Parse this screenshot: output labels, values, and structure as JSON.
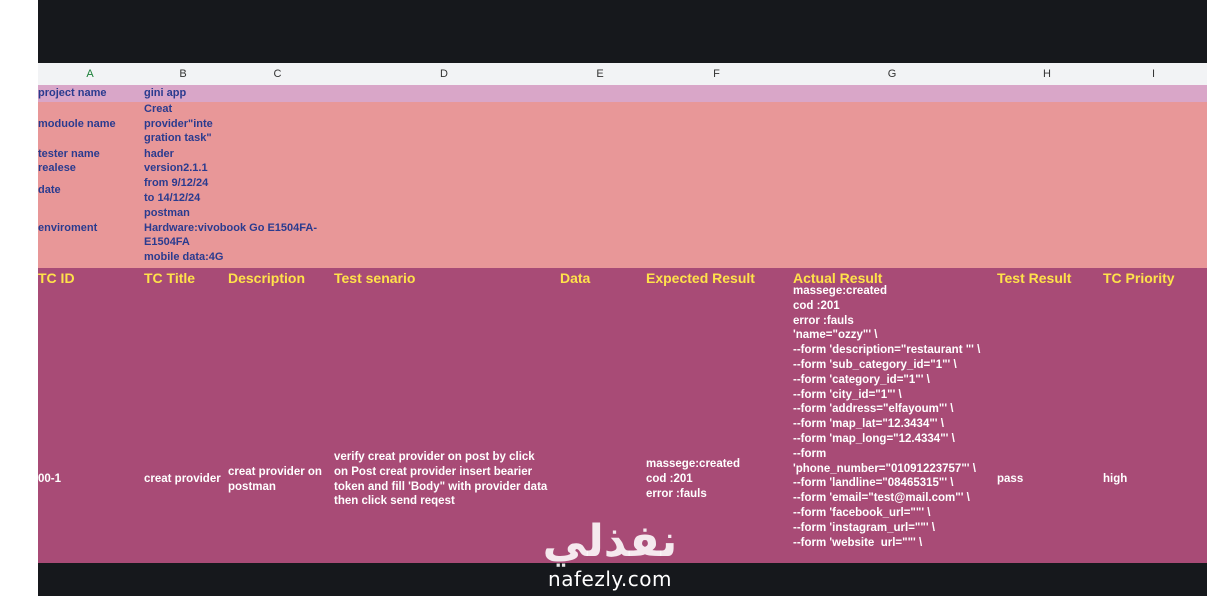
{
  "columns": [
    "A",
    "B",
    "C",
    "D",
    "E",
    "F",
    "G",
    "H",
    "I"
  ],
  "info": {
    "project_label": "project name",
    "project_value": "gini app",
    "module_label": "moduole name",
    "module_value": "Creat\nprovider\"inte\ngration task\"",
    "tester_label": "tester name",
    "tester_value": "hader",
    "release_label": "realese",
    "release_value": "version2.1.1",
    "date_label": "date",
    "date_value": "from 9/12/24\nto 14/12/24",
    "env_label": "enviroment",
    "env_value": "postman\nHardware:vivobook Go E1504FA-\nE1504FA\nmobile data:4G"
  },
  "table": {
    "headers": [
      "TC ID",
      "TC Title",
      "Description",
      "Test senario",
      "Data",
      "Expected Result",
      "Actual Result",
      "Test Result",
      "TC Priority"
    ],
    "row": {
      "id": "00-1",
      "title": "creat provider",
      "description": "creat provider on\npostman",
      "scenario": "verify creat provider on post by click\non Post creat provider insert bearier\ntoken and fill 'Body\" with provider data\nthen click send reqest",
      "data": "",
      "expected": "massege:created\ncod :201\nerror :fauls",
      "actual": "massege:created\ncod :201\nerror :fauls\n'name=\"ozzy\"' \\\n--form 'description=\"restaurant \"' \\\n--form 'sub_category_id=\"1\"' \\\n--form 'category_id=\"1\"' \\\n--form 'city_id=\"1\"' \\\n--form 'address=\"elfayoum\"' \\\n--form 'map_lat=\"12.3434\"' \\\n--form 'map_long=\"12.4334\"' \\\n--form\n'phone_number=\"01091223757\"' \\\n--form 'landline=\"08465315\"' \\\n--form 'email=\"test@mail.com\"' \\\n--form 'facebook_url=\"\"' \\\n--form 'instagram_url=\"\"' \\\n--form 'website  url=\"\"' \\\n\nconfirmation message appears",
      "result": "pass",
      "priority": "high"
    }
  },
  "watermark": {
    "arabic": "نفذلي",
    "latin": "nafezly.com"
  }
}
